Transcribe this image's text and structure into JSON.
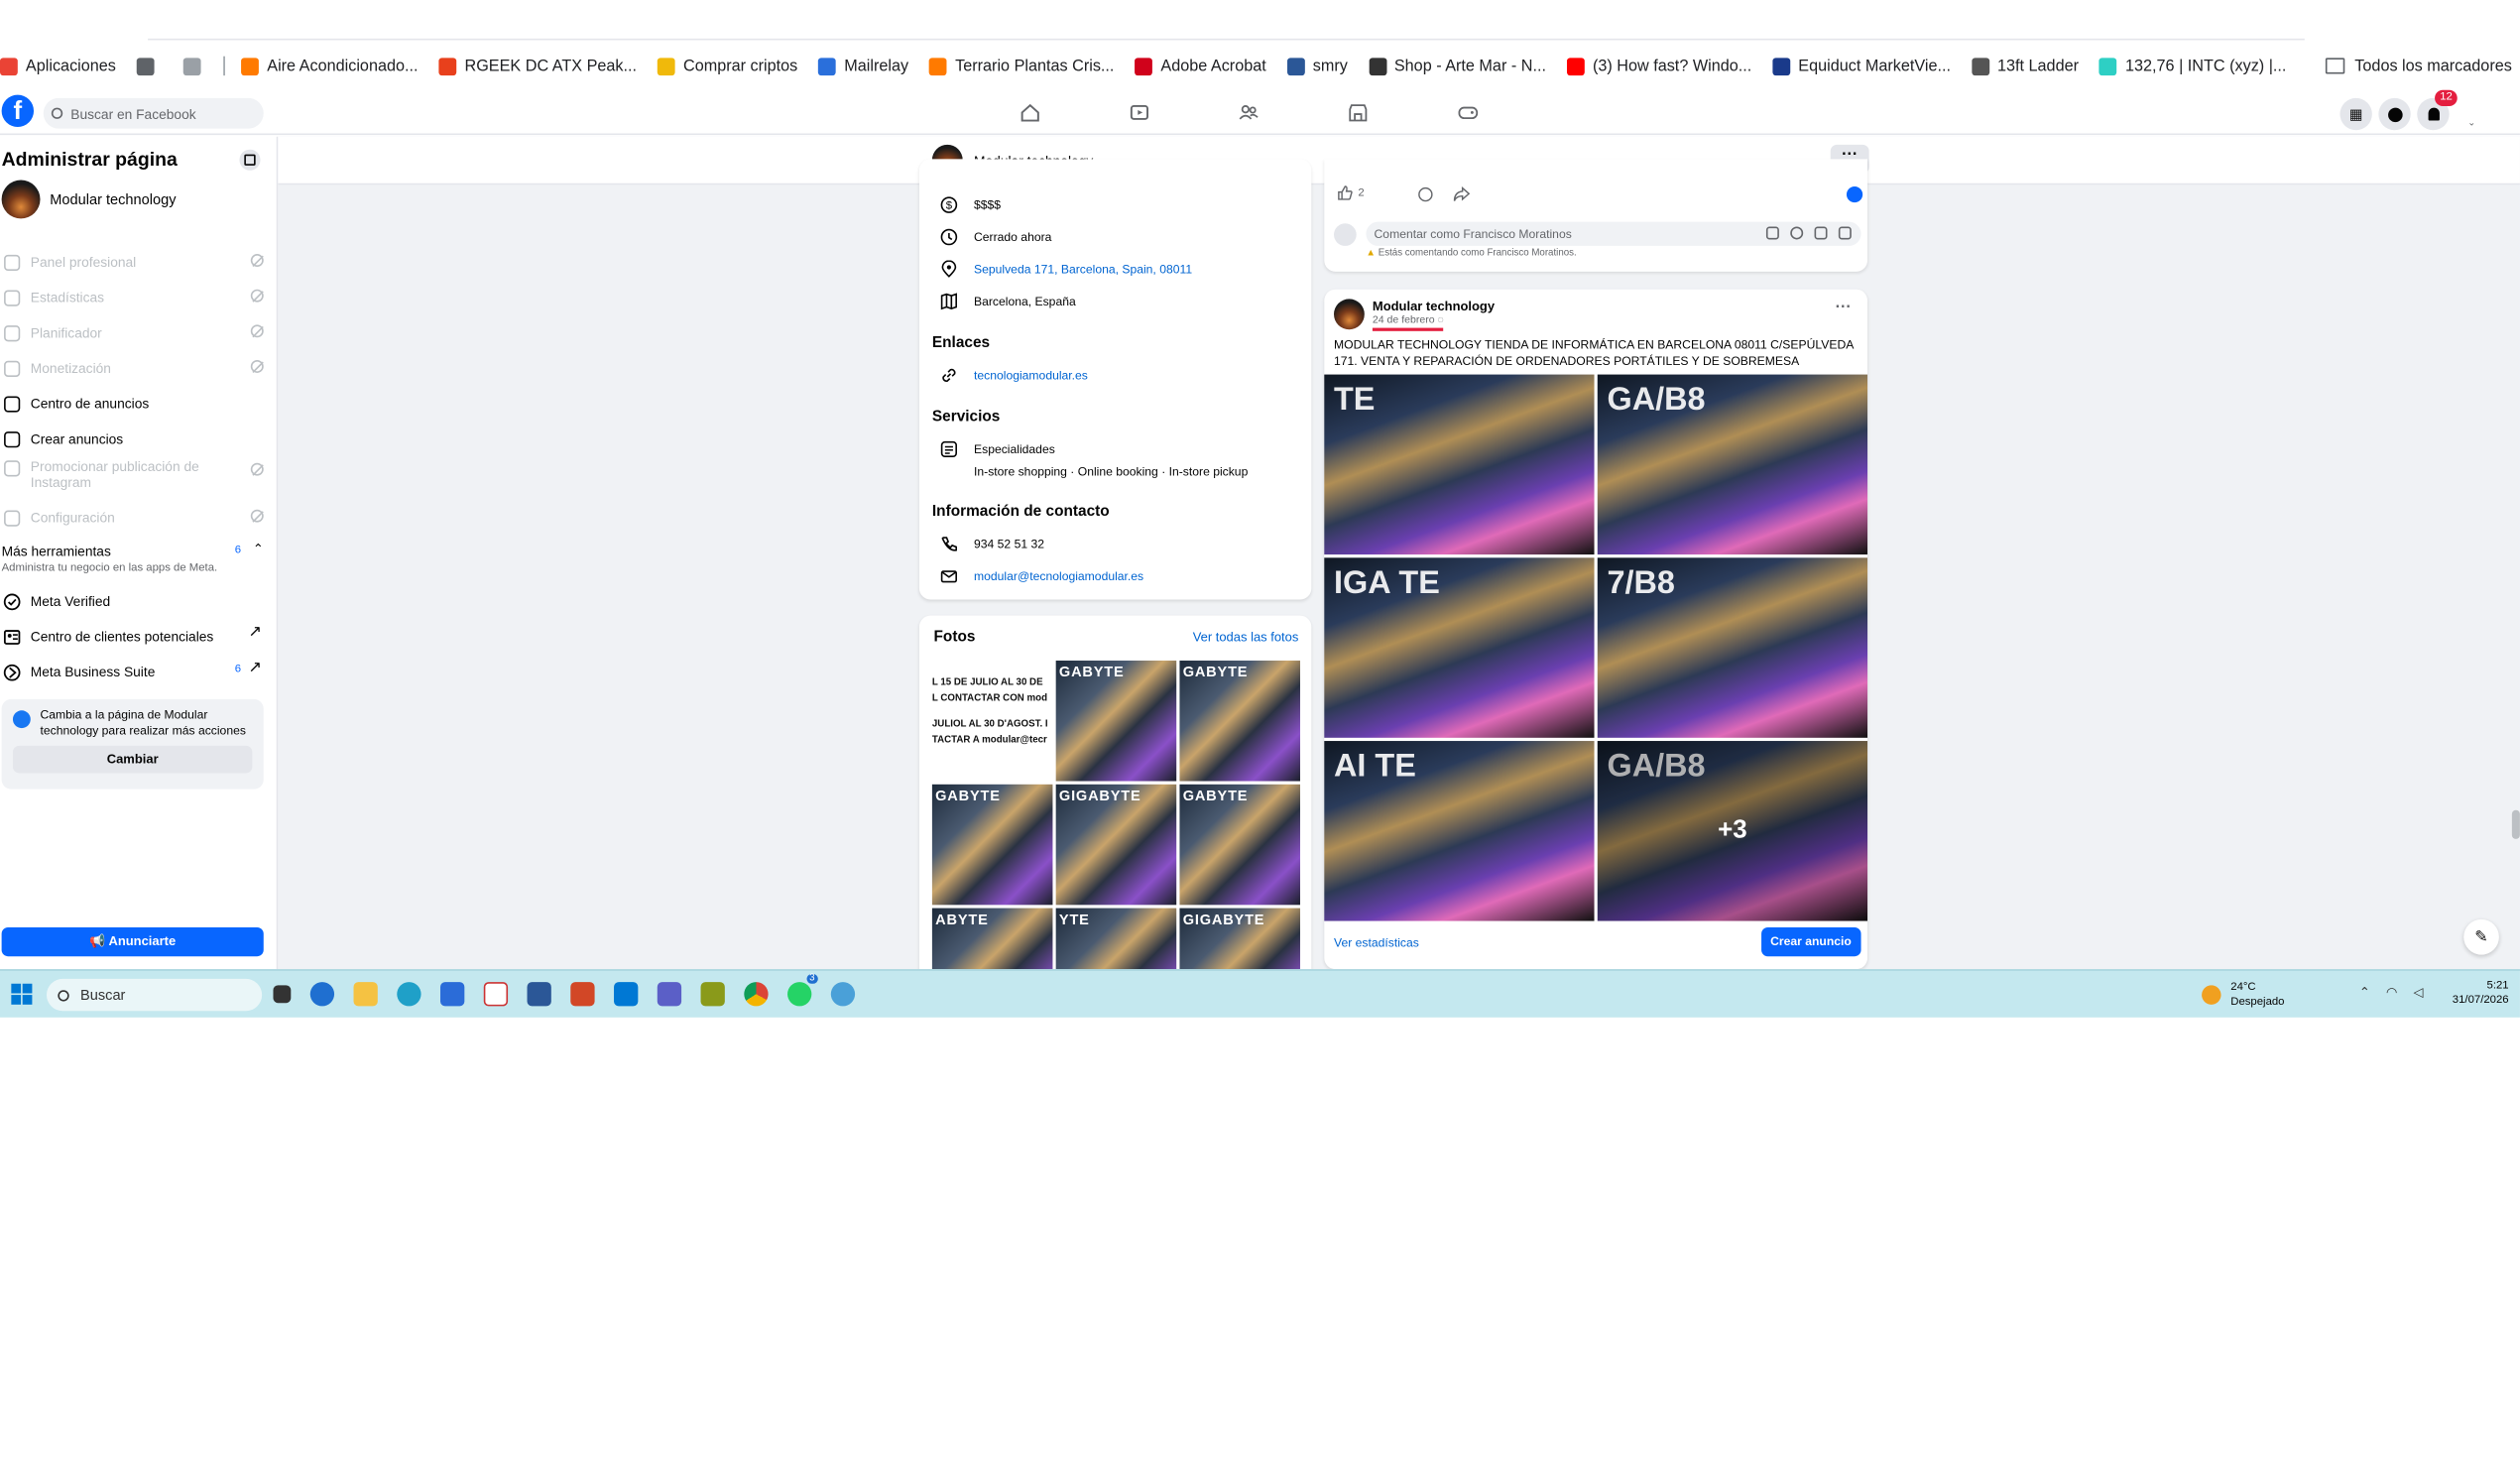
{
  "bookmarks": {
    "items": [
      {
        "label": "Aplicaciones",
        "color": "#ea4335"
      },
      {
        "label": "",
        "color": "#5f6368"
      },
      {
        "label": "",
        "color": "#9aa0a6"
      },
      {
        "label": "Aire Acondicionado...",
        "color": "#ff7a00"
      },
      {
        "label": "RGEEK DC ATX Peak...",
        "color": "#e8401c"
      },
      {
        "label": "Comprar criptos",
        "color": "#f0b90b"
      },
      {
        "label": "Mailrelay",
        "color": "#2a6fdb"
      },
      {
        "label": "Terrario Plantas Cris...",
        "color": "#ff7a00"
      },
      {
        "label": "Adobe Acrobat",
        "color": "#d0021b"
      },
      {
        "label": "smry",
        "color": "#2b5797"
      },
      {
        "label": "Shop - Arte Mar - N...",
        "color": "#333333"
      },
      {
        "label": "(3) How fast? Windo...",
        "color": "#ff0000"
      },
      {
        "label": "Equiduct MarketVie...",
        "color": "#1a3a8a"
      },
      {
        "label": "13ft Ladder",
        "color": "#555555"
      },
      {
        "label": "132,76 | INTC (xyz) |...",
        "color": "#2ecfc4"
      }
    ],
    "all_label": "Todos los marcadores"
  },
  "facebook": {
    "logo": "f",
    "search_placeholder": "Buscar en Facebook",
    "notifications_count": "12"
  },
  "sidebar": {
    "title": "Administrar página",
    "page_name": "Modular technology",
    "items": [
      {
        "label": "Panel profesional",
        "icon": "dashboard-icon",
        "disabled": true
      },
      {
        "label": "Estadísticas",
        "icon": "stats-icon",
        "disabled": true
      },
      {
        "label": "Planificador",
        "icon": "calendar-icon",
        "disabled": true
      },
      {
        "label": "Monetización",
        "icon": "money-icon",
        "disabled": true
      },
      {
        "label": "Centro de anuncios",
        "icon": "megaphone-icon",
        "disabled": false
      },
      {
        "label": "Crear anuncios",
        "icon": "edit-icon",
        "disabled": false
      },
      {
        "label": "Promocionar publicación de Instagram",
        "icon": "instagram-icon",
        "disabled": true
      },
      {
        "label": "Configuración",
        "icon": "settings-icon",
        "disabled": true
      }
    ],
    "more_tools": {
      "label": "Más herramientas",
      "count": "6",
      "sub": "Administra tu negocio en las apps de Meta."
    },
    "tools": [
      {
        "label": "Meta Verified"
      },
      {
        "label": "Centro de clientes potenciales"
      },
      {
        "label": "Meta Business Suite",
        "count": "6"
      }
    ],
    "switch_text": "Cambia a la página de Modular technology para realizar más acciones",
    "switch_button": "Cambiar",
    "advertise_button": "Anunciarte"
  },
  "page_header": {
    "name": "Modular technology",
    "more": "···"
  },
  "info": {
    "price": "$$$$",
    "hours": "Cerrado ahora",
    "address": "Sepulveda 171, Barcelona, Spain, 08011",
    "city": "Barcelona, España",
    "links_title": "Enlaces",
    "website": "tecnologiamodular.es",
    "services_title": "Servicios",
    "specialties_label": "Especialidades",
    "specialties": "In-store shopping · Online booking · In-store pickup",
    "contact_title": "Información de contacto",
    "phone": "934 52 51 32",
    "email": "modular@tecnologiamodular.es"
  },
  "photos": {
    "title": "Fotos",
    "see_all": "Ver todas las fotos",
    "text_tile_lines": [
      "L 15 DE JULIO AL 30 DE",
      "L CONTACTAR CON mod",
      "JULIOL AL 30 D'AGOST. I",
      "TACTAR A modular@tecr"
    ],
    "tile_labels": [
      "",
      "GABYTE",
      "GABYTE",
      "GABYTE",
      "GIGABYTE",
      "GABYTE",
      "ABYTE",
      "YTE",
      "GIGABYTE"
    ]
  },
  "post_top": {
    "likes": "2",
    "comment_placeholder": "Comentar como Francisco Moratinos",
    "warning": "Estás comentando como Francisco Moratinos."
  },
  "post": {
    "author": "Modular technology",
    "date": "24 de febrero",
    "text": "MODULAR TECHNOLOGY TIENDA DE INFORMÁTICA EN BARCELONA 08011 C/SEPÚLVEDA 171. VENTA Y REPARACIÓN DE ORDENADORES PORTÁTILES Y DE SOBREMESA",
    "image_labels": [
      "TE",
      "GA/B8",
      "IGA TE",
      "7/B8",
      "AI TE",
      "GA/B8"
    ],
    "more_count": "+3",
    "stats_link": "Ver estadísticas",
    "create_ad": "Crear anuncio"
  },
  "taskbar": {
    "search_placeholder": "Buscar",
    "whatsapp_badge": "3",
    "temperature": "24°C",
    "weather": "Despejado",
    "time": "5:21",
    "date": "31/07/2026"
  }
}
